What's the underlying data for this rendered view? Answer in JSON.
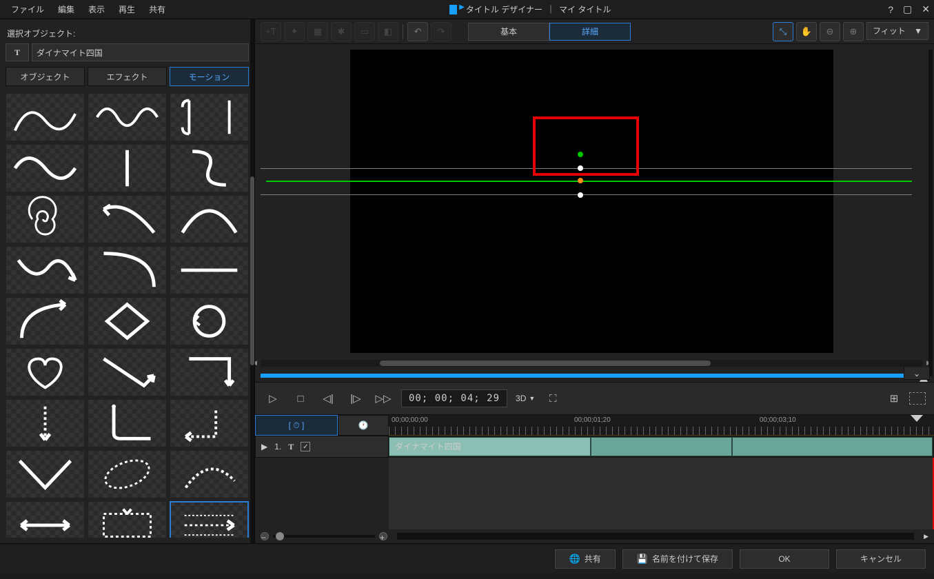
{
  "menu": [
    "ファイル",
    "編集",
    "表示",
    "再生",
    "共有"
  ],
  "app_title": "タイトル デザイナー",
  "title_sep": "｜",
  "doc_title": "マイ タイトル",
  "sidebar": {
    "select_label": "選択オブジェクト:",
    "object_icon": "T",
    "object_name": "ダイナマイト四国",
    "tabs": [
      "オブジェクト",
      "エフェクト",
      "モーション"
    ],
    "active_tab": 2
  },
  "toolbar": {
    "mode_basic": "基本",
    "mode_detail": "詳細",
    "fit_label": "フィット",
    "tri": "▼"
  },
  "playback": {
    "timecode": "00; 00; 04; 29",
    "td_label": "3D",
    "chev": "⌄"
  },
  "timeline": {
    "kf_icon": "[ ⏱ ]",
    "clock_icon": "🕐",
    "ruler_labels": [
      "00;00;00;00",
      "00;00;01;20",
      "00;00;03;10"
    ],
    "row": {
      "tri": "▶",
      "num": "1.",
      "icon": "T"
    },
    "clip_label": "ダイナマイト四国"
  },
  "footer": {
    "share": "共有",
    "save_as": "名前を付けて保存",
    "ok": "OK",
    "cancel": "キャンセル"
  }
}
